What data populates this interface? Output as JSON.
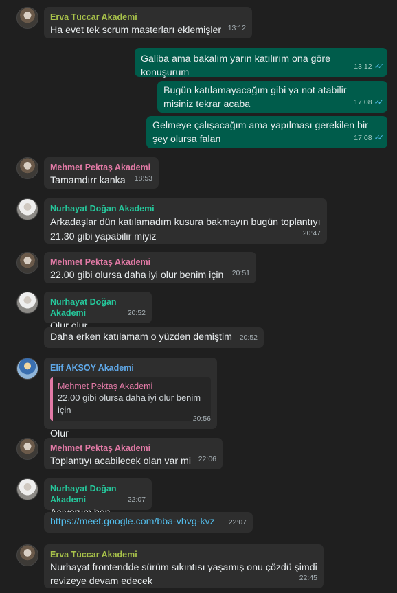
{
  "colors": {
    "erva": "#a8c24a",
    "mehmet": "#e27aa6",
    "nurhayat": "#25c79b",
    "elif": "#5fa8e8",
    "incoming_bg": "#2e2e2e",
    "outgoing_bg": "#005c4b",
    "link": "#53bdeb"
  },
  "messages": [
    {
      "sender": "Erva Tüccar Akademi",
      "text": "Ha evet tek scrum masterları eklemişler",
      "time": "13:12"
    },
    {
      "text": "Galiba ama bakalım yarın katılırım ona göre konuşurum",
      "time": "13:12",
      "ticks": "✓✓"
    },
    {
      "text": "Bugün katılamayacağım gibi ya not atabilir misiniz tekrar acaba",
      "time": "17:08",
      "ticks": "✓✓"
    },
    {
      "text": "Gelmeye çalışacağım ama yapılması gerekilen bir şey olursa falan",
      "time": "17:08",
      "ticks": "✓✓"
    },
    {
      "sender": "Mehmet Pektaş Akademi",
      "text": "Tamamdırr kanka",
      "time": "18:53"
    },
    {
      "sender": "Nurhayat Doğan Akademi",
      "text": "Arkadaşlar dün katılamadım kusura bakmayın bugün toplantıyı 21.30 gibi yapabilir miyiz",
      "time": "20:47"
    },
    {
      "sender": "Mehmet Pektaş Akademi",
      "text": "22.00 gibi olursa daha iyi olur benim için",
      "time": "20:51"
    },
    {
      "sender": "Nurhayat Doğan Akademi",
      "text": "Olur olur",
      "time": "20:52"
    },
    {
      "text": "Daha erken katılamam o yüzden demiştim",
      "time": "20:52"
    },
    {
      "sender": "Elif AKSOY Akademi",
      "quote_sender": "Mehmet Pektaş Akademi",
      "quote_text": "22.00 gibi olursa daha iyi olur benim için",
      "text": "Olur",
      "time": "20:56"
    },
    {
      "sender": "Mehmet Pektaş Akademi",
      "text": "Toplantıyı acabilecek olan var mi",
      "time": "22:06"
    },
    {
      "sender": "Nurhayat Doğan Akademi",
      "text": "Açıyorum ben",
      "time": "22:07"
    },
    {
      "text": "https://meet.google.com/bba-vbvg-kvz",
      "time": "22:07"
    },
    {
      "sender": "Erva Tüccar Akademi",
      "text": "Nurhayat frontendde sürüm sıkıntısı yaşamış onu çözdü şimdi revizeye devam edecek",
      "time": "22:45"
    }
  ]
}
